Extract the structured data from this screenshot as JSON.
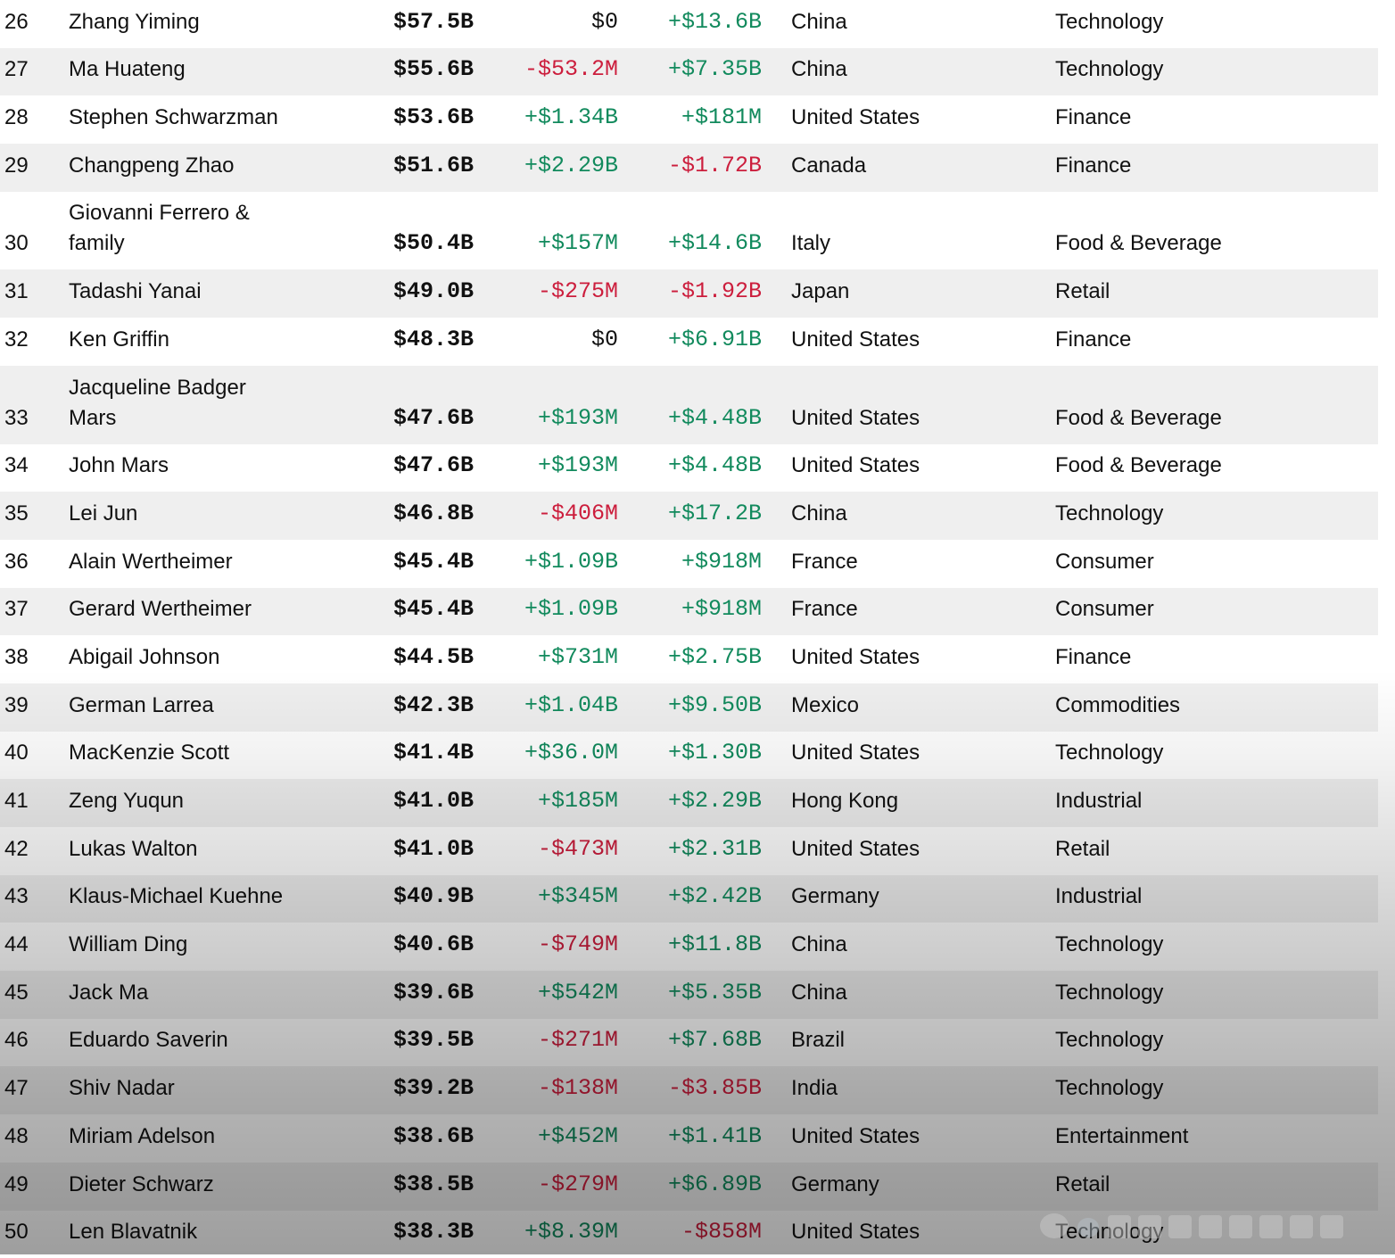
{
  "rows": [
    {
      "rank": "26",
      "name": "Zhang Yiming",
      "worth": "$57.5B",
      "last": "$0",
      "last_dir": "zero",
      "ytd": "+$13.6B",
      "ytd_dir": "pos",
      "country": "China",
      "industry": "Technology"
    },
    {
      "rank": "27",
      "name": "Ma Huateng",
      "worth": "$55.6B",
      "last": "-$53.2M",
      "last_dir": "neg",
      "ytd": "+$7.35B",
      "ytd_dir": "pos",
      "country": "China",
      "industry": "Technology"
    },
    {
      "rank": "28",
      "name": "Stephen Schwarzman",
      "worth": "$53.6B",
      "last": "+$1.34B",
      "last_dir": "pos",
      "ytd": "+$181M",
      "ytd_dir": "pos",
      "country": "United States",
      "industry": "Finance"
    },
    {
      "rank": "29",
      "name": "Changpeng Zhao",
      "worth": "$51.6B",
      "last": "+$2.29B",
      "last_dir": "pos",
      "ytd": "-$1.72B",
      "ytd_dir": "neg",
      "country": "Canada",
      "industry": "Finance"
    },
    {
      "rank": "30",
      "name": "Giovanni Ferrero & family",
      "worth": "$50.4B",
      "last": "+$157M",
      "last_dir": "pos",
      "ytd": "+$14.6B",
      "ytd_dir": "pos",
      "country": "Italy",
      "industry": "Food & Beverage",
      "tall": true
    },
    {
      "rank": "31",
      "name": "Tadashi Yanai",
      "worth": "$49.0B",
      "last": "-$275M",
      "last_dir": "neg",
      "ytd": "-$1.92B",
      "ytd_dir": "neg",
      "country": "Japan",
      "industry": "Retail"
    },
    {
      "rank": "32",
      "name": "Ken Griffin",
      "worth": "$48.3B",
      "last": "$0",
      "last_dir": "zero",
      "ytd": "+$6.91B",
      "ytd_dir": "pos",
      "country": "United States",
      "industry": "Finance"
    },
    {
      "rank": "33",
      "name": "Jacqueline Badger Mars",
      "worth": "$47.6B",
      "last": "+$193M",
      "last_dir": "pos",
      "ytd": "+$4.48B",
      "ytd_dir": "pos",
      "country": "United States",
      "industry": "Food & Beverage",
      "tall": true
    },
    {
      "rank": "34",
      "name": "John Mars",
      "worth": "$47.6B",
      "last": "+$193M",
      "last_dir": "pos",
      "ytd": "+$4.48B",
      "ytd_dir": "pos",
      "country": "United States",
      "industry": "Food & Beverage"
    },
    {
      "rank": "35",
      "name": "Lei Jun",
      "worth": "$46.8B",
      "last": "-$406M",
      "last_dir": "neg",
      "ytd": "+$17.2B",
      "ytd_dir": "pos",
      "country": "China",
      "industry": "Technology"
    },
    {
      "rank": "36",
      "name": "Alain Wertheimer",
      "worth": "$45.4B",
      "last": "+$1.09B",
      "last_dir": "pos",
      "ytd": "+$918M",
      "ytd_dir": "pos",
      "country": "France",
      "industry": "Consumer"
    },
    {
      "rank": "37",
      "name": "Gerard Wertheimer",
      "worth": "$45.4B",
      "last": "+$1.09B",
      "last_dir": "pos",
      "ytd": "+$918M",
      "ytd_dir": "pos",
      "country": "France",
      "industry": "Consumer"
    },
    {
      "rank": "38",
      "name": "Abigail Johnson",
      "worth": "$44.5B",
      "last": "+$731M",
      "last_dir": "pos",
      "ytd": "+$2.75B",
      "ytd_dir": "pos",
      "country": "United States",
      "industry": "Finance"
    },
    {
      "rank": "39",
      "name": "German Larrea",
      "worth": "$42.3B",
      "last": "+$1.04B",
      "last_dir": "pos",
      "ytd": "+$9.50B",
      "ytd_dir": "pos",
      "country": "Mexico",
      "industry": "Commodities"
    },
    {
      "rank": "40",
      "name": "MacKenzie Scott",
      "worth": "$41.4B",
      "last": "+$36.0M",
      "last_dir": "pos",
      "ytd": "+$1.30B",
      "ytd_dir": "pos",
      "country": "United States",
      "industry": "Technology"
    },
    {
      "rank": "41",
      "name": "Zeng Yuqun",
      "worth": "$41.0B",
      "last": "+$185M",
      "last_dir": "pos",
      "ytd": "+$2.29B",
      "ytd_dir": "pos",
      "country": "Hong Kong",
      "industry": "Industrial"
    },
    {
      "rank": "42",
      "name": "Lukas Walton",
      "worth": "$41.0B",
      "last": "-$473M",
      "last_dir": "neg",
      "ytd": "+$2.31B",
      "ytd_dir": "pos",
      "country": "United States",
      "industry": "Retail"
    },
    {
      "rank": "43",
      "name": "Klaus-Michael Kuehne",
      "worth": "$40.9B",
      "last": "+$345M",
      "last_dir": "pos",
      "ytd": "+$2.42B",
      "ytd_dir": "pos",
      "country": "Germany",
      "industry": "Industrial"
    },
    {
      "rank": "44",
      "name": "William Ding",
      "worth": "$40.6B",
      "last": "-$749M",
      "last_dir": "neg",
      "ytd": "+$11.8B",
      "ytd_dir": "pos",
      "country": "China",
      "industry": "Technology"
    },
    {
      "rank": "45",
      "name": "Jack Ma",
      "worth": "$39.6B",
      "last": "+$542M",
      "last_dir": "pos",
      "ytd": "+$5.35B",
      "ytd_dir": "pos",
      "country": "China",
      "industry": "Technology"
    },
    {
      "rank": "46",
      "name": "Eduardo Saverin",
      "worth": "$39.5B",
      "last": "-$271M",
      "last_dir": "neg",
      "ytd": "+$7.68B",
      "ytd_dir": "pos",
      "country": "Brazil",
      "industry": "Technology"
    },
    {
      "rank": "47",
      "name": "Shiv Nadar",
      "worth": "$39.2B",
      "last": "-$138M",
      "last_dir": "neg",
      "ytd": "-$3.85B",
      "ytd_dir": "neg",
      "country": "India",
      "industry": "Technology"
    },
    {
      "rank": "48",
      "name": "Miriam Adelson",
      "worth": "$38.6B",
      "last": "+$452M",
      "last_dir": "pos",
      "ytd": "+$1.41B",
      "ytd_dir": "pos",
      "country": "United States",
      "industry": "Entertainment"
    },
    {
      "rank": "49",
      "name": "Dieter Schwarz",
      "worth": "$38.5B",
      "last": "-$279M",
      "last_dir": "neg",
      "ytd": "+$6.89B",
      "ytd_dir": "pos",
      "country": "Germany",
      "industry": "Retail"
    },
    {
      "rank": "50",
      "name": "Len Blavatnik",
      "worth": "$38.3B",
      "last": "+$8.39M",
      "last_dir": "pos",
      "ytd": "-$858M",
      "ytd_dir": "neg",
      "country": "United States",
      "industry": "Technology"
    }
  ],
  "colors": {
    "positive": "#128a5d",
    "negative": "#cc1e3d",
    "row_alt": "#efefef"
  },
  "icons": {
    "watermark": "watermark-logo-icon"
  }
}
